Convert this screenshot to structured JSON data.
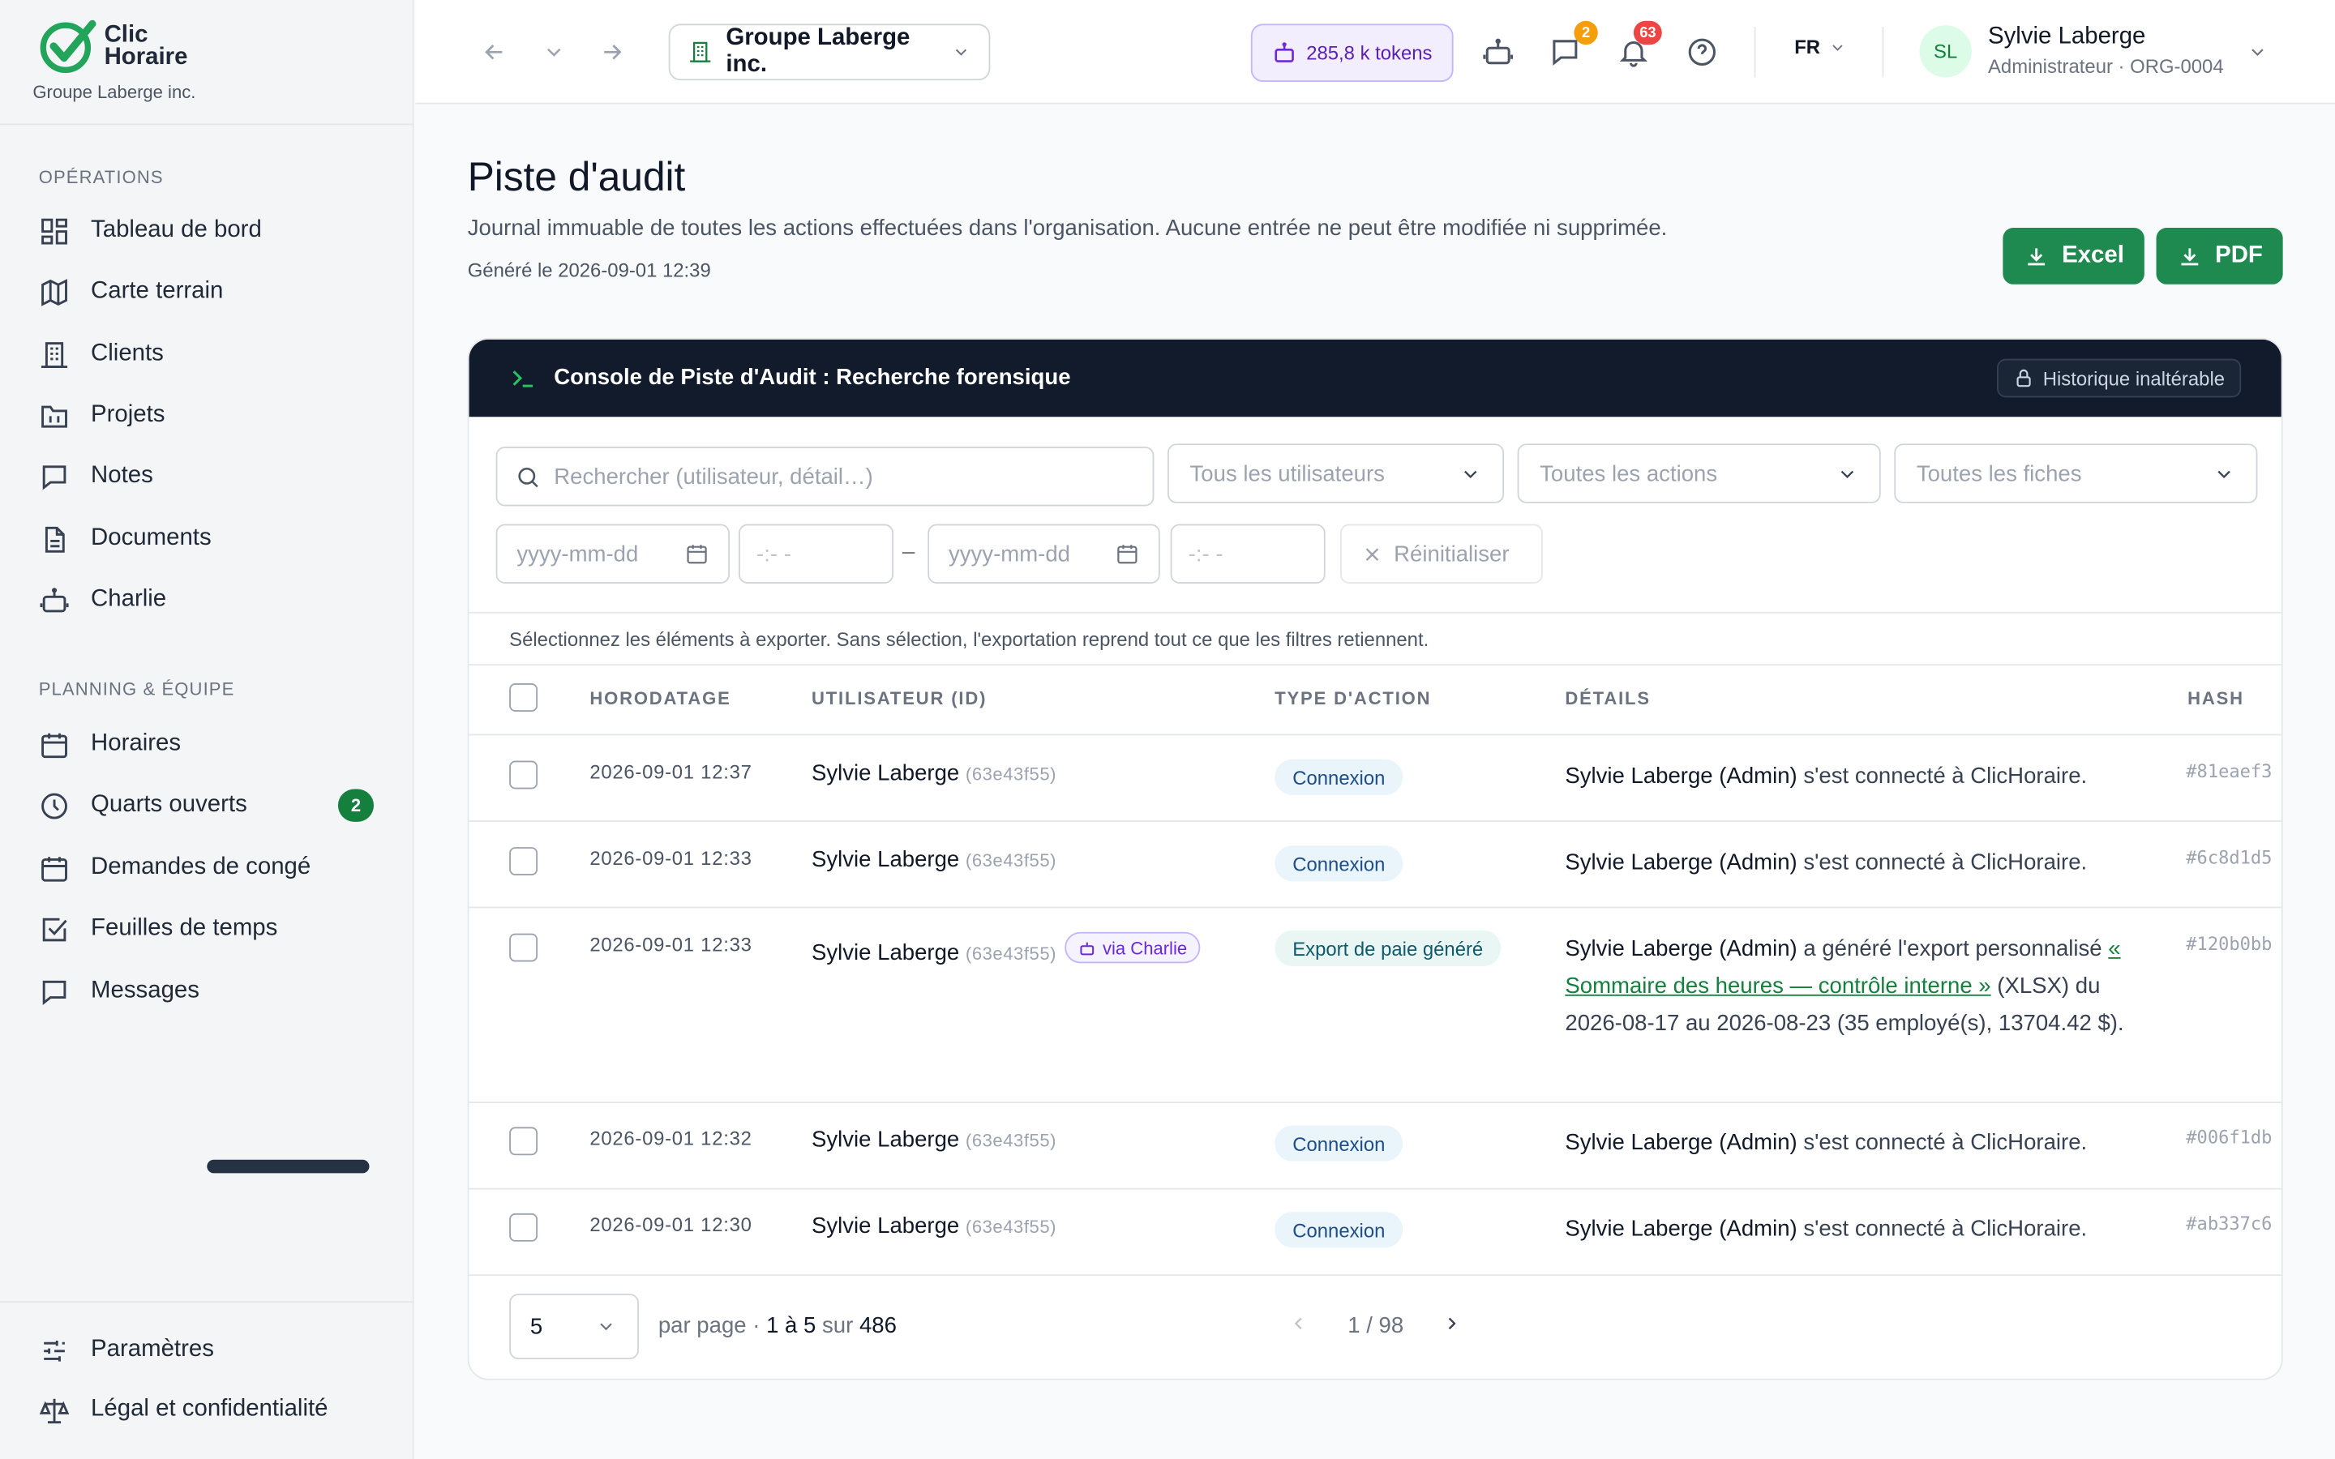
{
  "brand": {
    "logo_line1": "Clic",
    "logo_line2": "Horaire",
    "org": "Groupe Laberge inc."
  },
  "sidebar": {
    "sections": [
      {
        "label": "OPÉRATIONS",
        "items": [
          {
            "label": "Tableau de bord",
            "icon": "dashboard-icon"
          },
          {
            "label": "Carte terrain",
            "icon": "map-icon"
          },
          {
            "label": "Clients",
            "icon": "building-icon"
          },
          {
            "label": "Projets",
            "icon": "folder-icon"
          },
          {
            "label": "Notes",
            "icon": "note-icon"
          },
          {
            "label": "Documents",
            "icon": "document-icon"
          },
          {
            "label": "Charlie",
            "icon": "robot-icon"
          }
        ]
      },
      {
        "label": "PLANNING & ÉQUIPE",
        "items": [
          {
            "label": "Horaires",
            "icon": "calendar-icon"
          },
          {
            "label": "Quarts ouverts",
            "icon": "clock-icon",
            "badge": "2"
          },
          {
            "label": "Demandes de congé",
            "icon": "calendar-icon"
          },
          {
            "label": "Feuilles de temps",
            "icon": "checkbox-icon"
          },
          {
            "label": "Messages",
            "icon": "message-icon"
          }
        ]
      }
    ],
    "footer": [
      {
        "label": "Paramètres",
        "icon": "sliders-icon"
      },
      {
        "label": "Légal et confidentialité",
        "icon": "scale-icon"
      }
    ]
  },
  "topbar": {
    "org_selector": "Groupe Laberge inc.",
    "tokens": "285,8 k tokens",
    "messages_count": "2",
    "notifications_count": "63",
    "lang": "FR",
    "user_name": "Sylvie Laberge",
    "user_role": "Administrateur · ORG-0004",
    "avatar_initials": "SL"
  },
  "page": {
    "title": "Piste d'audit",
    "subtitle": "Journal immuable de toutes les actions effectuées dans l'organisation. Aucune entrée ne peut être modifiée ni supprimée.",
    "generated": "Généré le 2026-09-01 12:39",
    "export_excel": "Excel",
    "export_pdf": "PDF"
  },
  "console": {
    "title": "Console de Piste d'Audit : Recherche forensique",
    "badge": "Historique inaltérable"
  },
  "filters": {
    "search_placeholder": "Rechercher (utilisateur, détail…)",
    "users": "Tous les utilisateurs",
    "actions": "Toutes les actions",
    "records": "Toutes les fiches",
    "date_from": "yyyy-mm-dd",
    "time_from": "-:- -",
    "dash": "–",
    "date_to": "yyyy-mm-dd",
    "time_to": "-:- -",
    "reset": "Réinitialiser"
  },
  "hint": "Sélectionnez les éléments à exporter. Sans sélection, l'exportation reprend tout ce que les filtres retiennent.",
  "table": {
    "headers": [
      "HORODATAGE",
      "UTILISATEUR (ID)",
      "TYPE D'ACTION",
      "DÉTAILS",
      "HASH"
    ],
    "rows": [
      {
        "ts": "2026-09-01 12:37",
        "user": "Sylvie Laberge",
        "uid": "(63e43f55)",
        "action": "Connexion",
        "actor": "Sylvie Laberge (Admin)",
        "detail": " s'est connecté à ClicHoraire.",
        "hash": "#81eaef3"
      },
      {
        "ts": "2026-09-01 12:33",
        "user": "Sylvie Laberge",
        "uid": "(63e43f55)",
        "action": "Connexion",
        "actor": "Sylvie Laberge (Admin)",
        "detail": " s'est connecté à ClicHoraire.",
        "hash": "#6c8d1d5"
      },
      {
        "ts": "2026-09-01 12:33",
        "user": "Sylvie Laberge",
        "uid": "(63e43f55)",
        "via": "via Charlie",
        "action": "Export de paie généré",
        "actor": "Sylvie Laberge (Admin)",
        "detail_pre": " a généré l'export personnalisé ",
        "detail_link": "« Sommaire des heures — contrôle interne »",
        "detail_post": " (XLSX) du 2026-08-17 au 2026-08-23 (35 employé(s), 13704.42 $).",
        "hash": "#120b0bb"
      },
      {
        "ts": "2026-09-01 12:32",
        "user": "Sylvie Laberge",
        "uid": "(63e43f55)",
        "action": "Connexion",
        "actor": "Sylvie Laberge (Admin)",
        "detail": " s'est connecté à ClicHoraire.",
        "hash": "#006f1db"
      },
      {
        "ts": "2026-09-01 12:30",
        "user": "Sylvie Laberge",
        "uid": "(63e43f55)",
        "action": "Connexion",
        "actor": "Sylvie Laberge (Admin)",
        "detail": " s'est connecté à ClicHoraire.",
        "hash": "#ab337c6"
      }
    ]
  },
  "pagination": {
    "per_page": "5",
    "per_page_label": "par page · ",
    "range": "1 à 5",
    "of": " sur ",
    "total": "486",
    "page": "1 / 98"
  }
}
